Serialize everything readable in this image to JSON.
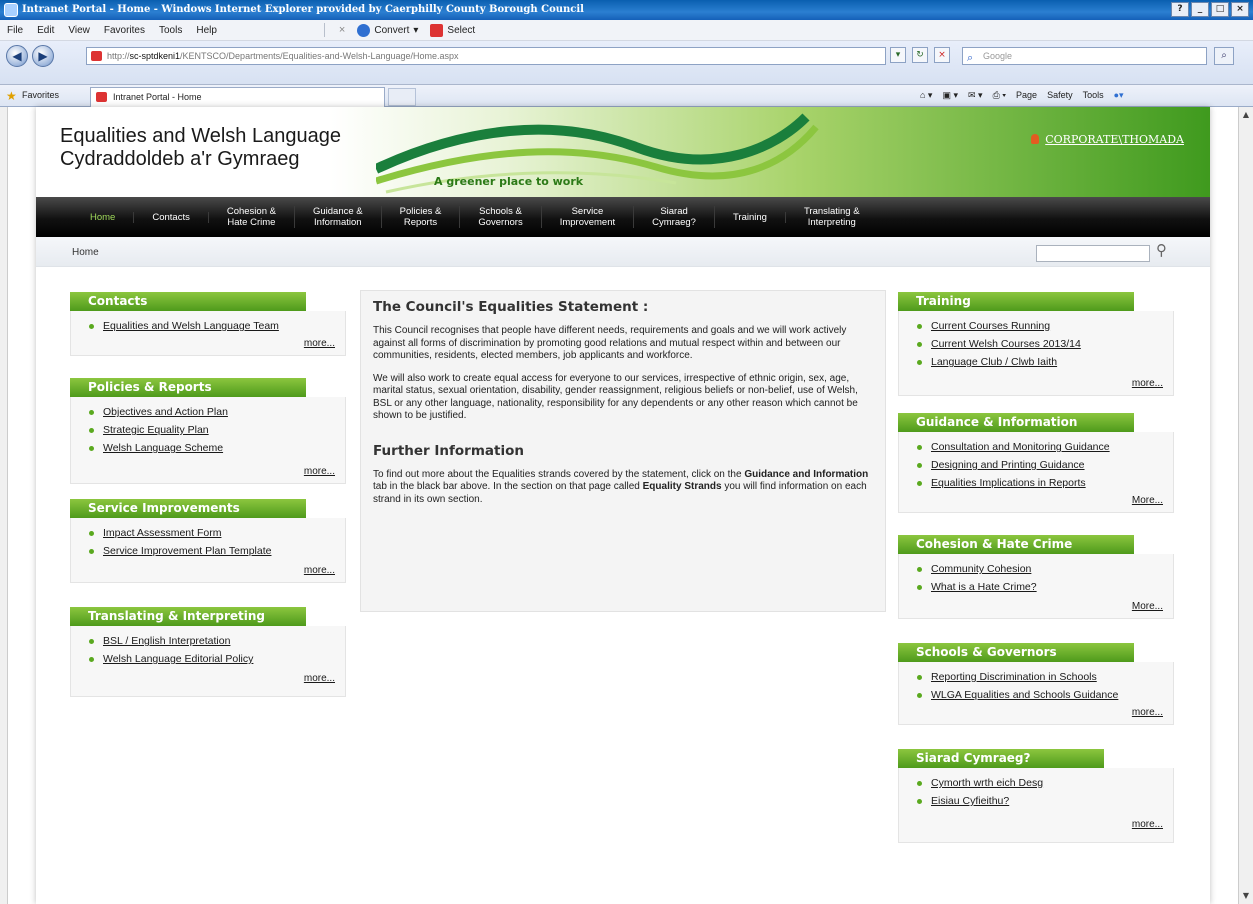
{
  "browser": {
    "window_title": "Intranet Portal - Home - Windows Internet Explorer provided by Caerphilly County Borough Council",
    "menu": [
      "File",
      "Edit",
      "View",
      "Favorites",
      "Tools",
      "Help"
    ],
    "toolbar": {
      "convert_label": "Convert",
      "select_label": "Select"
    },
    "address_prefix": "http://",
    "address_host": "sc-sptdkeni1",
    "address_path": "/KENTSCO/Departments/Equalities-and-Welsh-Language/Home.aspx",
    "search_placeholder": "Google",
    "favorites_label": "Favorites",
    "tab_title": "Intranet Portal - Home",
    "command_bar": [
      "Page",
      "Safety",
      "Tools"
    ]
  },
  "site": {
    "title_en": "Equalities and Welsh Language",
    "title_cy": "Cydraddoldeb a'r Gymraeg",
    "tagline": "A greener place to work",
    "user": "CORPORATE\\THOMADA",
    "nav": [
      "Home",
      "Contacts",
      "Cohesion &\nHate Crime",
      "Guidance &\nInformation",
      "Policies &\nReports",
      "Schools &\nGovernors",
      "Service\nImprovement",
      "Siarad\nCymraeg?",
      "Training",
      "Translating &\nInterpreting"
    ],
    "breadcrumb": "Home",
    "more_label": "more..."
  },
  "left": [
    {
      "title": "Contacts",
      "items": [
        "Equalities and Welsh Language Team"
      ],
      "more": "more..."
    },
    {
      "title": "Policies & Reports",
      "items": [
        "Objectives and Action Plan",
        "Strategic Equality Plan",
        "Welsh Language Scheme"
      ],
      "more": "more..."
    },
    {
      "title": "Service Improvements",
      "items": [
        "Impact Assessment Form",
        "Service Improvement Plan Template"
      ],
      "more": "more..."
    },
    {
      "title": "Translating & Interpreting",
      "items": [
        "BSL / English Interpretation",
        "Welsh Language Editorial Policy"
      ],
      "more": "more..."
    }
  ],
  "center": {
    "heading": "The Council's Equalities Statement :",
    "para1": "This Council recognises that people have different needs, requirements and goals and we will work actively against all forms of discrimination by promoting good relations and mutual respect within and between our communities, residents, elected members, job applicants and workforce.",
    "para2": "We will also work to create equal access for everyone to our services, irrespective of ethnic origin, sex, age, marital status, sexual orientation, disability, gender reassignment, religious beliefs or non-belief, use of Welsh, BSL or any other language, nationality, responsibility for any dependents or any other reason which cannot be shown to be justified.",
    "heading2": "Further Information",
    "para3_a": "To find out more about the Equalities strands covered by the statement, click on the ",
    "para3_b": "Guidance and Information",
    "para3_c": " tab in the black bar above. In the section on that page called ",
    "para3_d": "Equality Strands",
    "para3_e": " you will find information on each strand in its own section."
  },
  "right": [
    {
      "title": "Training",
      "items": [
        "Current Courses Running",
        "Current Welsh Courses 2013/14",
        "Language Club / Clwb Iaith"
      ],
      "more": "more..."
    },
    {
      "title": "Guidance & Information",
      "items": [
        "Consultation and Monitoring Guidance",
        "Designing and Printing Guidance",
        "Equalities Implications in Reports"
      ],
      "more": "More..."
    },
    {
      "title": "Cohesion & Hate Crime",
      "items": [
        "Community Cohesion",
        "What is a Hate Crime?"
      ],
      "more": "More..."
    },
    {
      "title": "Schools & Governors",
      "items": [
        "Reporting Discrimination in Schools",
        "WLGA Equalities and Schools Guidance"
      ],
      "more": "more..."
    },
    {
      "title": "Siarad Cymraeg?",
      "items": [
        "Cymorth wrth eich Desg",
        "Eisiau Cyfieithu?"
      ],
      "more": "more..."
    }
  ],
  "colors": {
    "accent_green": "#5aa91f",
    "nav_black": "#111111",
    "active_nav": "#9fd85b"
  }
}
